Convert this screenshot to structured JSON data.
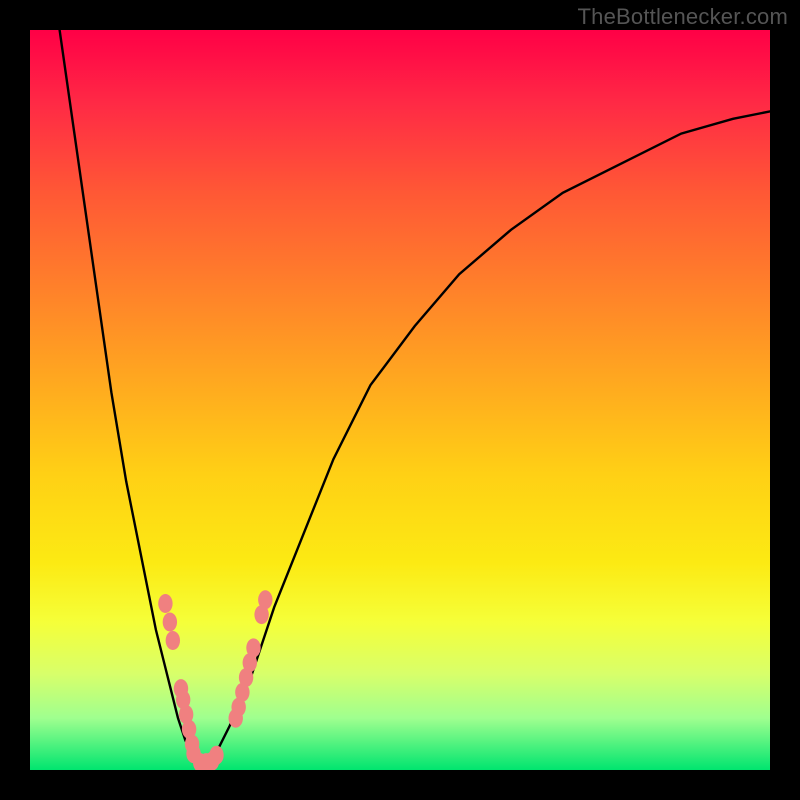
{
  "watermark": {
    "text": "TheBottlenecker.com"
  },
  "chart_data": {
    "type": "line",
    "title": "",
    "xlabel": "",
    "ylabel": "",
    "xlim": [
      0,
      100
    ],
    "ylim": [
      0,
      100
    ],
    "series": [
      {
        "name": "left-curve",
        "description": "left branch descending from top-left toward the minimum",
        "x": [
          4,
          5,
          6,
          7,
          8,
          9,
          10,
          11,
          12,
          13,
          14,
          15,
          16,
          17,
          18,
          19,
          20,
          21,
          22,
          23
        ],
        "y": [
          100,
          93,
          86,
          79,
          72,
          65,
          58,
          51,
          45,
          39,
          34,
          29,
          24,
          19,
          15,
          11,
          7,
          4,
          2,
          0.5
        ]
      },
      {
        "name": "right-curve",
        "description": "right branch rising from the minimum out toward the right edge",
        "x": [
          23,
          25,
          27,
          30,
          33,
          37,
          41,
          46,
          52,
          58,
          65,
          72,
          80,
          88,
          95,
          100
        ],
        "y": [
          0.5,
          2,
          6,
          13,
          22,
          32,
          42,
          52,
          60,
          67,
          73,
          78,
          82,
          86,
          88,
          89
        ]
      }
    ],
    "minimum": {
      "x": 23,
      "y": 0.5
    },
    "markers": {
      "name": "data-beads",
      "description": "pink oval markers clustered near the minimum on both branches",
      "color": "#F08080",
      "points": [
        {
          "branch": "left",
          "x": 18.3,
          "y": 22.5
        },
        {
          "branch": "left",
          "x": 18.9,
          "y": 20.0
        },
        {
          "branch": "left",
          "x": 19.3,
          "y": 17.5
        },
        {
          "branch": "left",
          "x": 20.4,
          "y": 11.0
        },
        {
          "branch": "left",
          "x": 20.7,
          "y": 9.5
        },
        {
          "branch": "left",
          "x": 21.1,
          "y": 7.5
        },
        {
          "branch": "left",
          "x": 21.5,
          "y": 5.5
        },
        {
          "branch": "left",
          "x": 21.9,
          "y": 3.5
        },
        {
          "branch": "left",
          "x": 22.1,
          "y": 2.2
        },
        {
          "branch": "right",
          "x": 23.0,
          "y": 1.0
        },
        {
          "branch": "right",
          "x": 23.8,
          "y": 1.0
        },
        {
          "branch": "right",
          "x": 24.6,
          "y": 1.2
        },
        {
          "branch": "right",
          "x": 25.2,
          "y": 2.0
        },
        {
          "branch": "right",
          "x": 27.8,
          "y": 7.0
        },
        {
          "branch": "right",
          "x": 28.2,
          "y": 8.5
        },
        {
          "branch": "right",
          "x": 28.7,
          "y": 10.5
        },
        {
          "branch": "right",
          "x": 29.2,
          "y": 12.5
        },
        {
          "branch": "right",
          "x": 29.7,
          "y": 14.5
        },
        {
          "branch": "right",
          "x": 30.2,
          "y": 16.5
        },
        {
          "branch": "right",
          "x": 31.3,
          "y": 21.0
        },
        {
          "branch": "right",
          "x": 31.8,
          "y": 23.0
        }
      ]
    },
    "background": {
      "gradient": "vertical",
      "stops": [
        {
          "pos": 0.0,
          "color": "#ff0046"
        },
        {
          "pos": 0.5,
          "color": "#ffaa1f"
        },
        {
          "pos": 0.8,
          "color": "#f5ff39"
        },
        {
          "pos": 1.0,
          "color": "#00e56f"
        }
      ]
    }
  }
}
